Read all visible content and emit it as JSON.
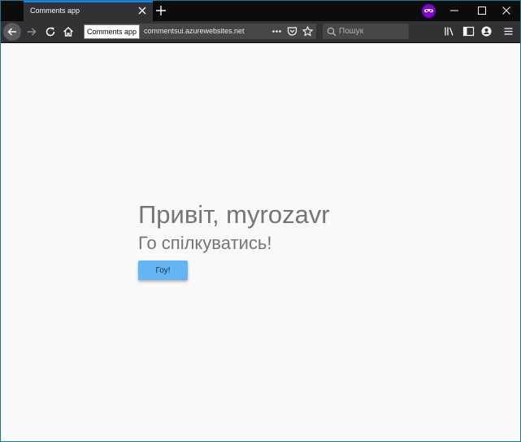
{
  "browser": {
    "tab": {
      "title": "Comments app"
    },
    "tooltip": "Comments app",
    "url": "commentsui.azurewebsites.net",
    "search": {
      "placeholder": "Пошук",
      "value": ""
    },
    "private_icon_color": "#8000d7",
    "accent_color": "#0a84ff"
  },
  "page": {
    "greeting": "Привіт, myrozavr",
    "subtitle": "Го спілкуватись!",
    "go_button_label": "Гоу!",
    "button_color": "#64b5f6"
  }
}
